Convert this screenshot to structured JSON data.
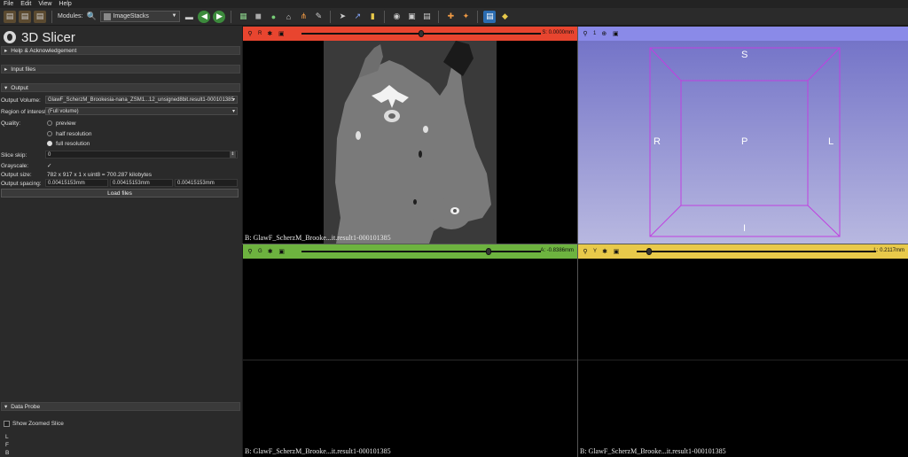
{
  "menu": [
    "File",
    "Edit",
    "View",
    "Help"
  ],
  "toolbar": {
    "modules_label": "Modules:",
    "module_value": "ImageStacks"
  },
  "app_title": "3D Slicer",
  "sections": {
    "help": "Help & Acknowledgement",
    "input": "Input files",
    "output": "Output",
    "probe": "Data Probe"
  },
  "output": {
    "volume_label": "Output Volume:",
    "volume_value": "GlawF_ScherzM_Brookesia-nana_ZSM1...12_unsigned8bit.result1-000101385",
    "roi_label": "Region of interest:",
    "roi_value": "(Full volume)",
    "quality_label": "Quality:",
    "quality_options": [
      "preview",
      "half resolution",
      "full resolution"
    ],
    "quality_selected": "full resolution",
    "skip_label": "Slice skip:",
    "skip_value": "0",
    "gray_label": "Grayscale:",
    "gray_value": "✓",
    "size_label": "Output size:",
    "size_value": "782 x 917 x 1 x uint8 = 700.287 kilobytes",
    "spacing_label": "Output spacing:",
    "spacing_values": [
      "0.00415153mm",
      "0.00415153mm",
      "0.00415153mm"
    ],
    "load_button": "Load files"
  },
  "probe": {
    "show_zoomed": "Show Zoomed Slice",
    "coords": [
      "L",
      "F",
      "B"
    ]
  },
  "views": {
    "red": {
      "letter": "R",
      "value": "S: 0.0000mm",
      "label": "B: GlawF_ScherzM_Brooke...it.result1-000101385",
      "slider": 0.5
    },
    "threeD": {
      "letter": "1",
      "orient": {
        "top": "S",
        "bottom": "I",
        "left": "R",
        "right": "L",
        "center": "P"
      }
    },
    "green": {
      "letter": "G",
      "value": "A: -0.8386mm",
      "label": "B: GlawF_ScherzM_Brooke...it.result1-000101385",
      "slider": 0.78
    },
    "yellow": {
      "letter": "Y",
      "value": "L: 0.2117mm",
      "label": "B: GlawF_ScherzM_Brooke...it.result1-000101385",
      "slider": 0.05
    }
  },
  "colors": {
    "red": "#e8452f",
    "green": "#6db33f",
    "yellow": "#e8c94a",
    "threeD": "#8a8ae8",
    "roi_box": "#c040e0"
  }
}
